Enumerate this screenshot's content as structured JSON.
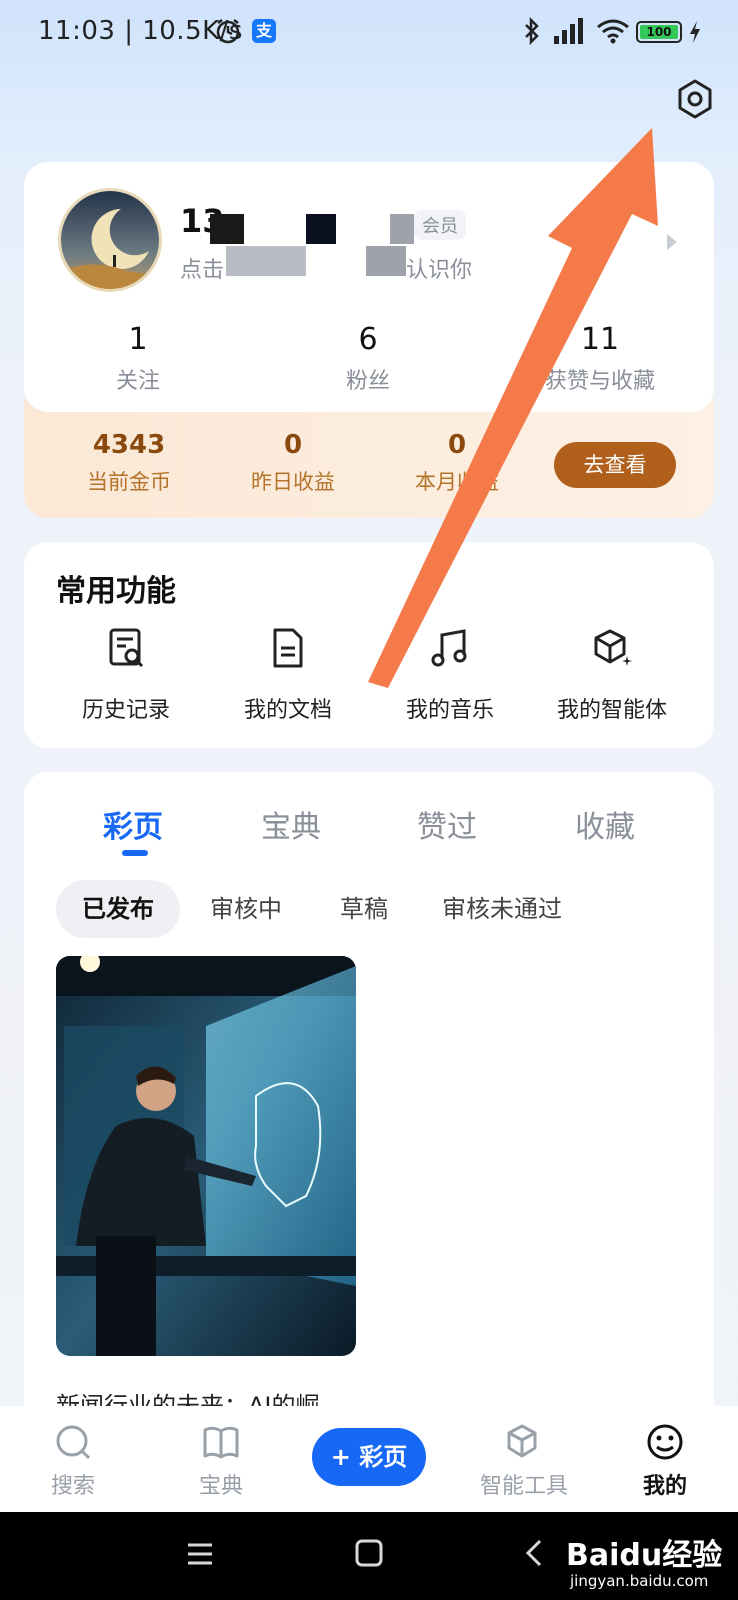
{
  "status_bar": {
    "time": "11:03 | 10.5K/s",
    "battery": "100",
    "alipay_badge": "支"
  },
  "header": {
    "settings_icon": "hexagon-settings-icon"
  },
  "profile": {
    "name_visible": "13",
    "member_badge": "会员",
    "subtitle_visible_start": "点击",
    "subtitle_visible_end": "认识你",
    "stats": [
      {
        "num": "1",
        "label": "关注"
      },
      {
        "num": "6",
        "label": "粉丝"
      },
      {
        "num": "11",
        "label": "获赞与收藏"
      }
    ]
  },
  "coins": {
    "items": [
      {
        "num": "4343",
        "label": "当前金币"
      },
      {
        "num": "0",
        "label": "昨日收益"
      },
      {
        "num": "0",
        "label": "本月收益"
      }
    ],
    "button": "去查看"
  },
  "functions": {
    "title": "常用功能",
    "items": [
      {
        "label": "历史记录",
        "icon": "history-icon"
      },
      {
        "label": "我的文档",
        "icon": "document-icon"
      },
      {
        "label": "我的音乐",
        "icon": "music-icon"
      },
      {
        "label": "我的智能体",
        "icon": "agent-cube-icon"
      }
    ]
  },
  "tabs": {
    "main": [
      "彩页",
      "宝典",
      "赞过",
      "收藏"
    ],
    "sub": [
      "已发布",
      "审核中",
      "草稿",
      "审核未通过"
    ]
  },
  "post": {
    "title": "新闻行业的未来：AI的崛"
  },
  "bottom_nav": {
    "items": [
      {
        "label": "搜索",
        "icon": "search-icon"
      },
      {
        "label": "宝典",
        "icon": "book-icon"
      },
      {
        "label": "智能工具",
        "icon": "cube-icon"
      },
      {
        "label": "我的",
        "icon": "face-icon"
      }
    ],
    "create_button": "+ 彩页"
  },
  "watermark": {
    "brand": "Baidu经验",
    "url": "jingyan.baidu.com"
  },
  "colors": {
    "accent": "#1768f5",
    "coin_button": "#b0601a",
    "annotation_arrow": "#f47a4a"
  }
}
